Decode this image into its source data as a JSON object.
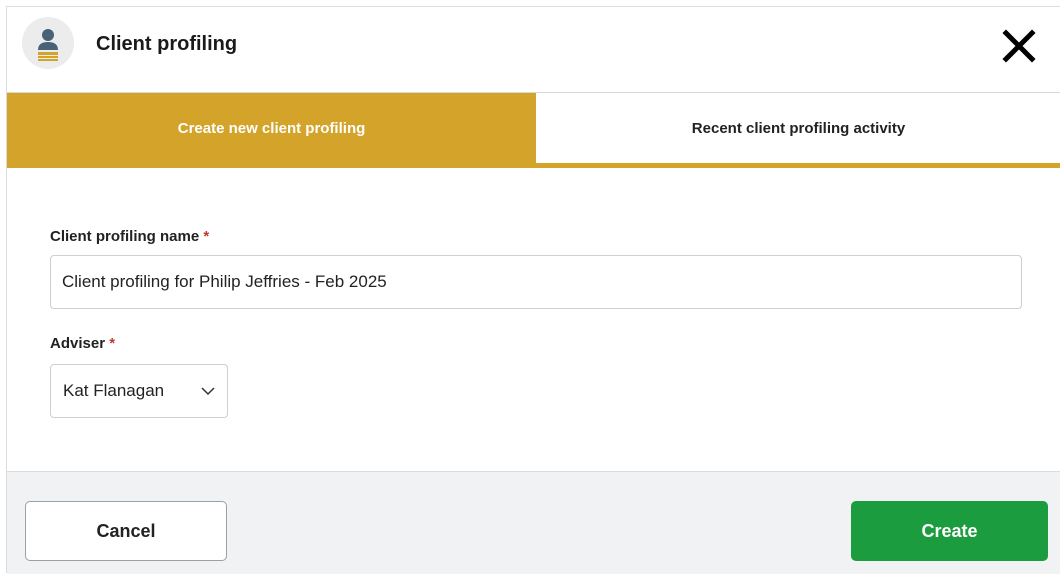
{
  "header": {
    "title": "Client profiling",
    "avatar_icon": "user-profile-icon",
    "close_icon": "close-icon"
  },
  "tabs": [
    {
      "label": "Create new client profiling",
      "active": true
    },
    {
      "label": "Recent client profiling activity",
      "active": false
    }
  ],
  "form": {
    "name_label": "Client profiling name",
    "name_required": "*",
    "name_value": "Client profiling for Philip Jeffries - Feb 2025",
    "adviser_label": "Adviser",
    "adviser_required": "*",
    "adviser_value": "Kat Flanagan",
    "adviser_icon": "chevron-down-icon"
  },
  "footer": {
    "cancel_label": "Cancel",
    "create_label": "Create"
  },
  "colors": {
    "accent": "#d4a32a",
    "create_button": "#1b9c3e",
    "required": "#c0392b"
  }
}
